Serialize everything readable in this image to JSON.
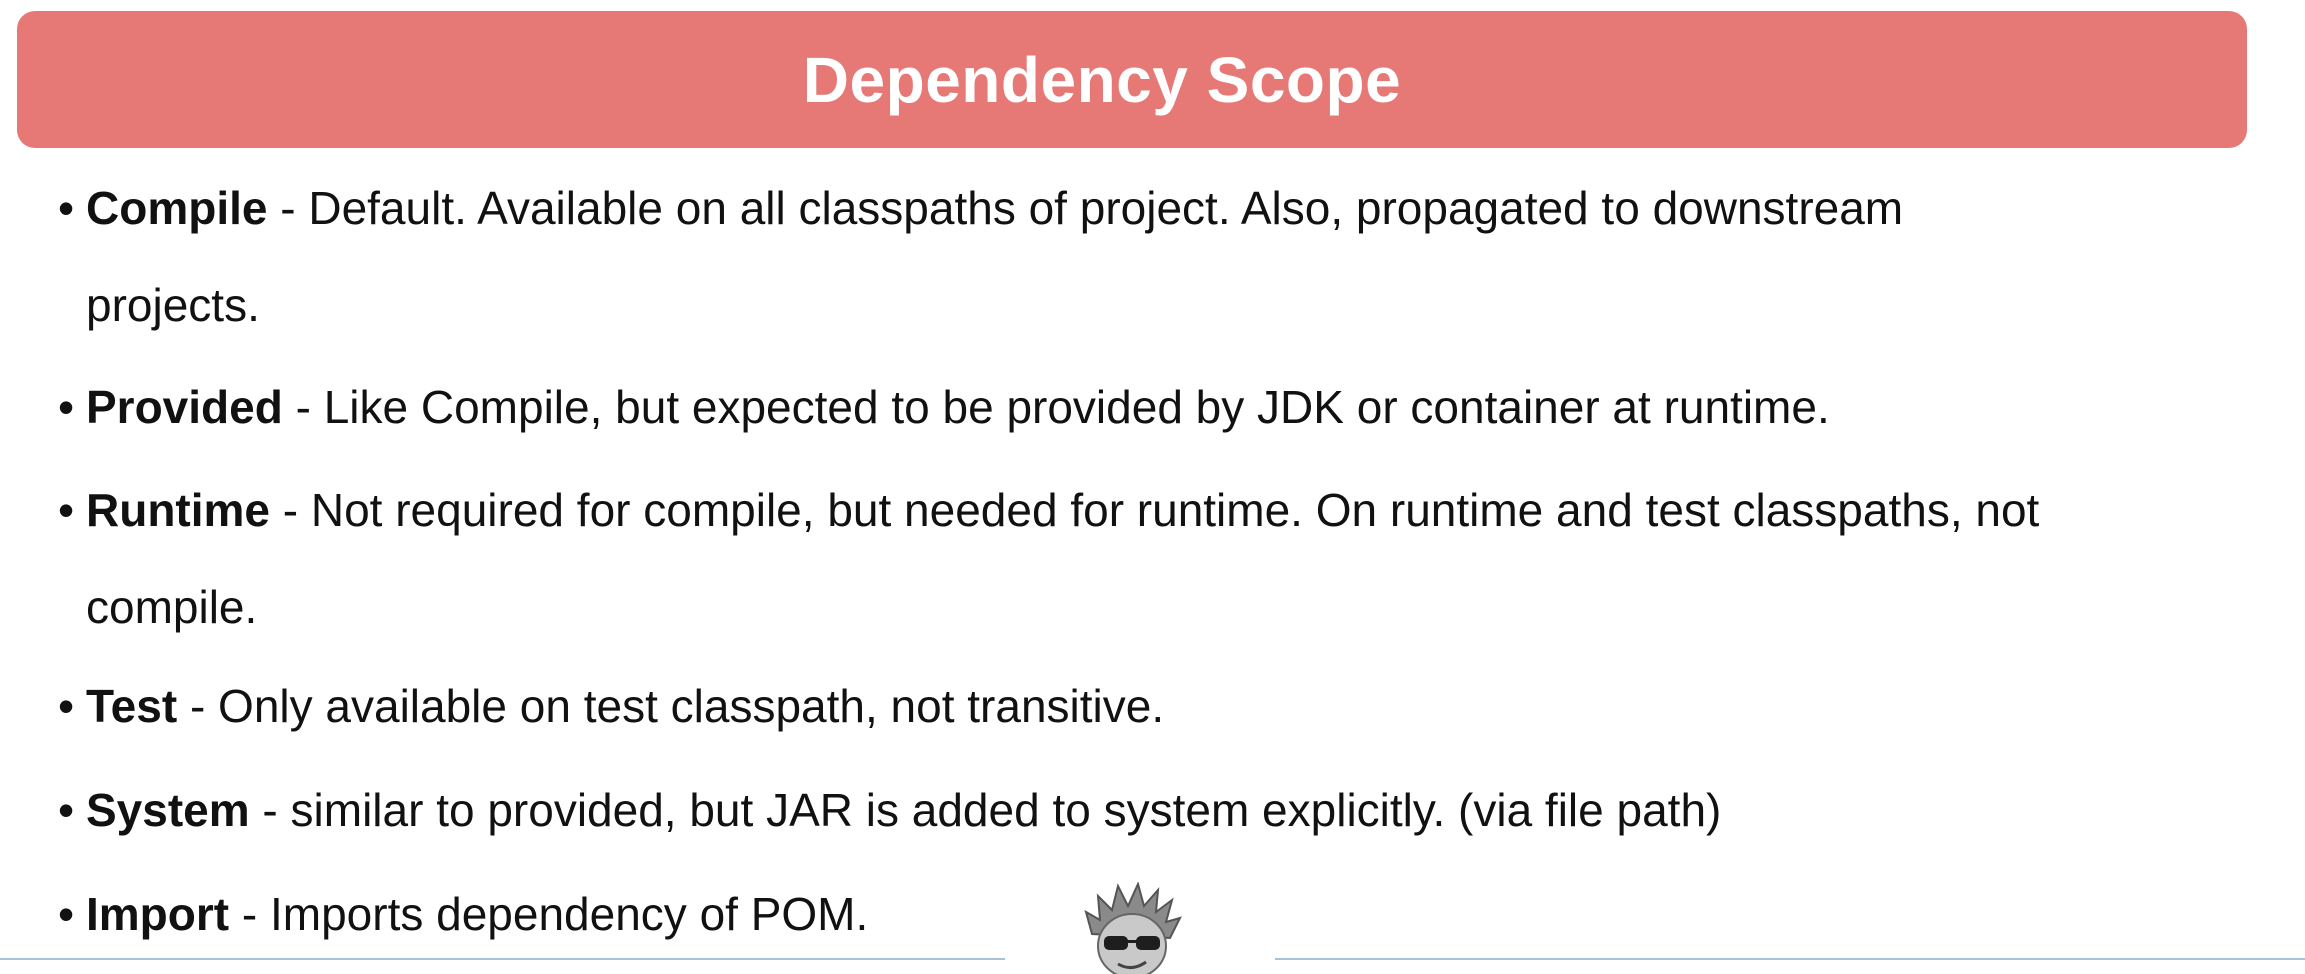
{
  "title": "Dependency Scope",
  "bullets": [
    {
      "term": "Compile",
      "text": " - Default. Available on all classpaths of project.  Also, propagated to downstream",
      "continuation": "projects."
    },
    {
      "term": "Provided",
      "text": " - Like Compile, but expected to be provided by JDK or container at runtime."
    },
    {
      "term": "Runtime",
      "text": " - Not required for compile, but needed for runtime. On runtime and test classpaths, not",
      "continuation": "compile."
    },
    {
      "term": "Test",
      "text": " - Only available on test classpath, not transitive."
    },
    {
      "term": "System",
      "text": " - similar to provided, but JAR is added to system explicitly. (via file path)"
    },
    {
      "term": "Import",
      "text": " - Imports dependency of POM."
    }
  ],
  "colors": {
    "title_bar": "#e67876",
    "title_text": "#ffffff",
    "divider": "#a8c3d8"
  },
  "icons": {
    "avatar": "presenter-avatar-icon"
  }
}
